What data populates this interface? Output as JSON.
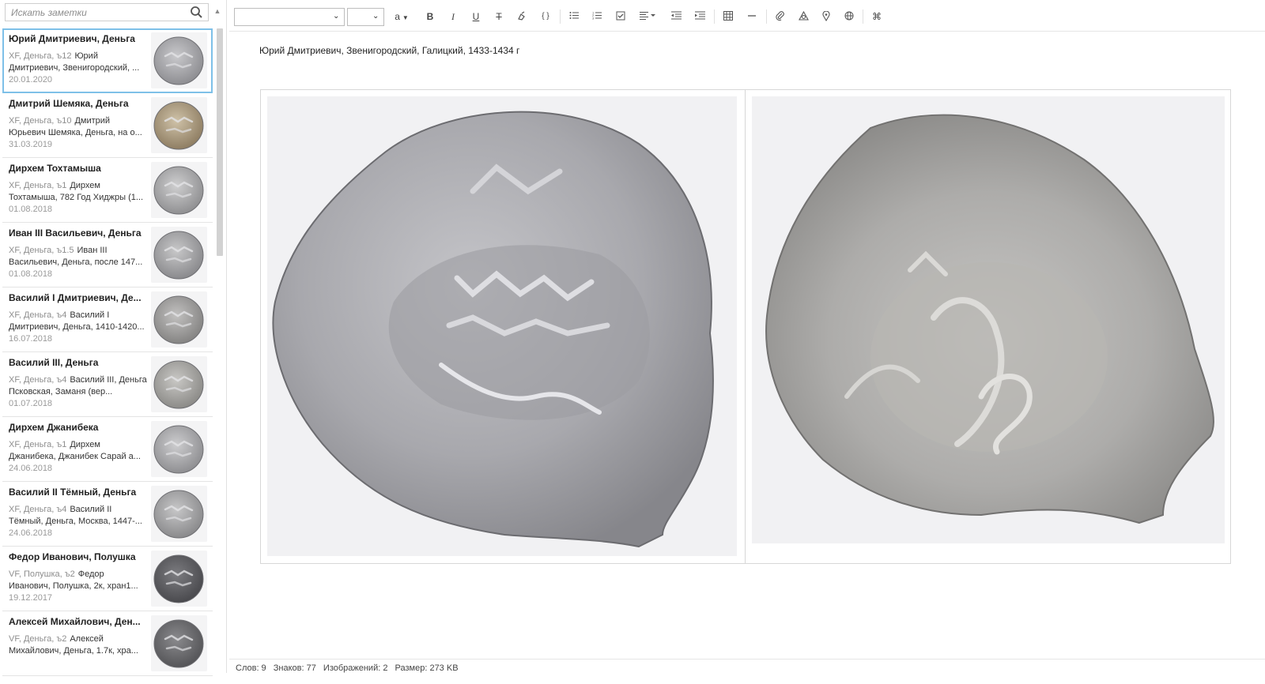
{
  "search": {
    "placeholder": "Искать заметки"
  },
  "notes": [
    {
      "title": "Юрий Дмитриевич, Деньга",
      "meta": "XF, Деньга, ъ12",
      "snippet": "Юрий Дмитриевич, Звенигородский, ...",
      "date": "20.01.2020",
      "selected": true
    },
    {
      "title": "Дмитрий Шемяка, Деньга",
      "meta": "XF, Деньга, ъ10",
      "snippet": "Дмитрий Юрьевич Шемяка, Деньга, на о...",
      "date": "31.03.2019"
    },
    {
      "title": "Дирхем Тохтамыша",
      "meta": "XF, Деньга, ъ1",
      "snippet": "Дирхем Тохтамыша, 782 Год Хиджры (1...",
      "date": "01.08.2018"
    },
    {
      "title": "Иван III Васильевич, Деньга",
      "meta": "XF, Деньга, ъ1.5",
      "snippet": "Иван III Васильевич, Деньга, после 147...",
      "date": "01.08.2018"
    },
    {
      "title": "Василий I Дмитриевич, Де...",
      "meta": "XF, Деньга, ъ4",
      "snippet": "Василий I Дмитриевич, Деньга, 1410-1420...",
      "date": "16.07.2018"
    },
    {
      "title": "Василий III, Деньга",
      "meta": "XF, Деньга, ъ4",
      "snippet": "Василий III, Деньга Псковская, Заманя (вер...",
      "date": "01.07.2018"
    },
    {
      "title": "Дирхем Джанибека",
      "meta": "XF, Деньга, ъ1",
      "snippet": "Дирхем Джанибека, Джанибек Сарай а...",
      "date": "24.06.2018"
    },
    {
      "title": "Василий II Тёмный, Деньга",
      "meta": "XF, Деньга, ъ4",
      "snippet": "Василий II Тёмный, Деньга, Москва, 1447-...",
      "date": "24.06.2018"
    },
    {
      "title": "Федор Иванович, Полушка",
      "meta": "VF, Полушка, ъ2",
      "snippet": "Федор Иванович, Полушка, 2к, хран1...",
      "date": "19.12.2017"
    },
    {
      "title": "Алексей Михайлович, Ден...",
      "meta": "VF, Деньга, ъ2",
      "snippet": "Алексей Михайлович, Деньга, 1.7к, хра...",
      "date": ""
    }
  ],
  "toolbar": {
    "font_family_value": "",
    "font_size_value": "",
    "text_color_label": "a",
    "buttons": [
      "bold-icon",
      "italic-icon",
      "underline-icon",
      "strikethrough-icon",
      "highlight-icon",
      "code-icon",
      "bulleted-list-icon",
      "numbered-list-icon",
      "checklist-icon",
      "align-icon",
      "outdent-icon",
      "indent-icon",
      "table-icon",
      "horizontal-rule-icon",
      "attachment-icon",
      "drawing-icon",
      "map-pin-icon",
      "globe-icon",
      "command-icon"
    ]
  },
  "document": {
    "title": "Юрий Дмитриевич, Звенигородский, Галицкий, 1433-1434 г"
  },
  "status": {
    "words": "Слов: 9",
    "chars": "Знаков: 77",
    "images": "Изображений: 2",
    "size": "Размер: 273 KB"
  },
  "colors": {
    "selection": "#7ec0e8",
    "coin": "#a9a9ad",
    "coin_dark": "#7f7f84",
    "accent_icon": "#555555"
  }
}
